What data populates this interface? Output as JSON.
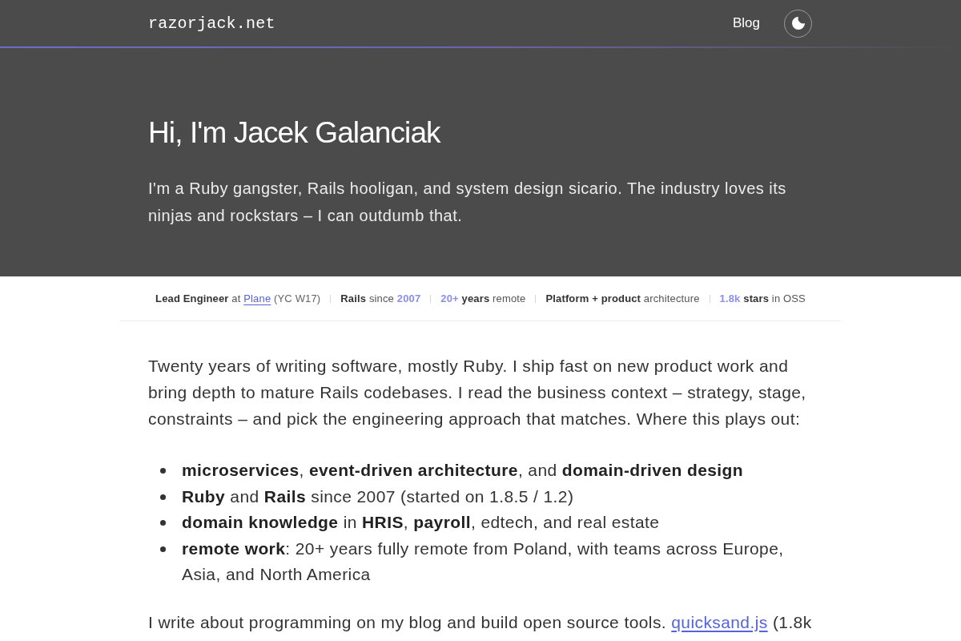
{
  "header": {
    "logo": "razorjack.net",
    "nav": [
      {
        "label": "Blog"
      }
    ]
  },
  "hero": {
    "title": "Hi, I'm Jacek Galanciak",
    "subtitle": "I'm a Ruby gangster, Rails hooligan, and system design sicario. The industry loves its ninjas and rockstars – I can outdumb that."
  },
  "facts": [
    {
      "parts": [
        {
          "kind": "strong",
          "text": "Lead Engineer"
        },
        {
          "kind": "plain",
          "text": "at"
        },
        {
          "kind": "link",
          "text": "Plane"
        },
        {
          "kind": "muted",
          "text": "(YC W17)"
        }
      ]
    },
    {
      "parts": [
        {
          "kind": "strong",
          "text": "Rails"
        },
        {
          "kind": "plain",
          "text": "since"
        },
        {
          "kind": "accent",
          "text": "2007"
        }
      ]
    },
    {
      "parts": [
        {
          "kind": "accent",
          "text": "20+"
        },
        {
          "kind": "strong",
          "text": "years"
        },
        {
          "kind": "plain",
          "text": "remote"
        }
      ]
    },
    {
      "parts": [
        {
          "kind": "strong",
          "text": "Platform + product"
        },
        {
          "kind": "plain",
          "text": "architecture"
        }
      ]
    },
    {
      "parts": [
        {
          "kind": "accent",
          "text": "1.8k"
        },
        {
          "kind": "strong",
          "text": "stars"
        },
        {
          "kind": "plain",
          "text": "in OSS"
        }
      ]
    }
  ],
  "intro": "Twenty years of writing software, mostly Ruby. I ship fast on new product work and bring depth to mature Rails codebases. I read the business context – strategy, stage, constraints – and pick the engineering approach that matches. Where this plays out:",
  "highlights": [
    "**microservices**, **event-driven architecture**, and **domain-driven design**",
    "**Ruby** and **Rails** since 2007 (started on 1.8.5 / 1.2)",
    "**domain knowledge** in **HRIS**, **payroll**, edtech, and real estate",
    "**remote work**: 20+ years fully remote from Poland, with teams across Europe, Asia, and North America"
  ],
  "closing": {
    "parts": [
      {
        "kind": "text",
        "text": "I write about programming on my blog and build open source tools."
      },
      {
        "kind": "link",
        "text": "quicksand.js"
      },
      {
        "kind": "text",
        "text": "(1.8k"
      }
    ]
  }
}
